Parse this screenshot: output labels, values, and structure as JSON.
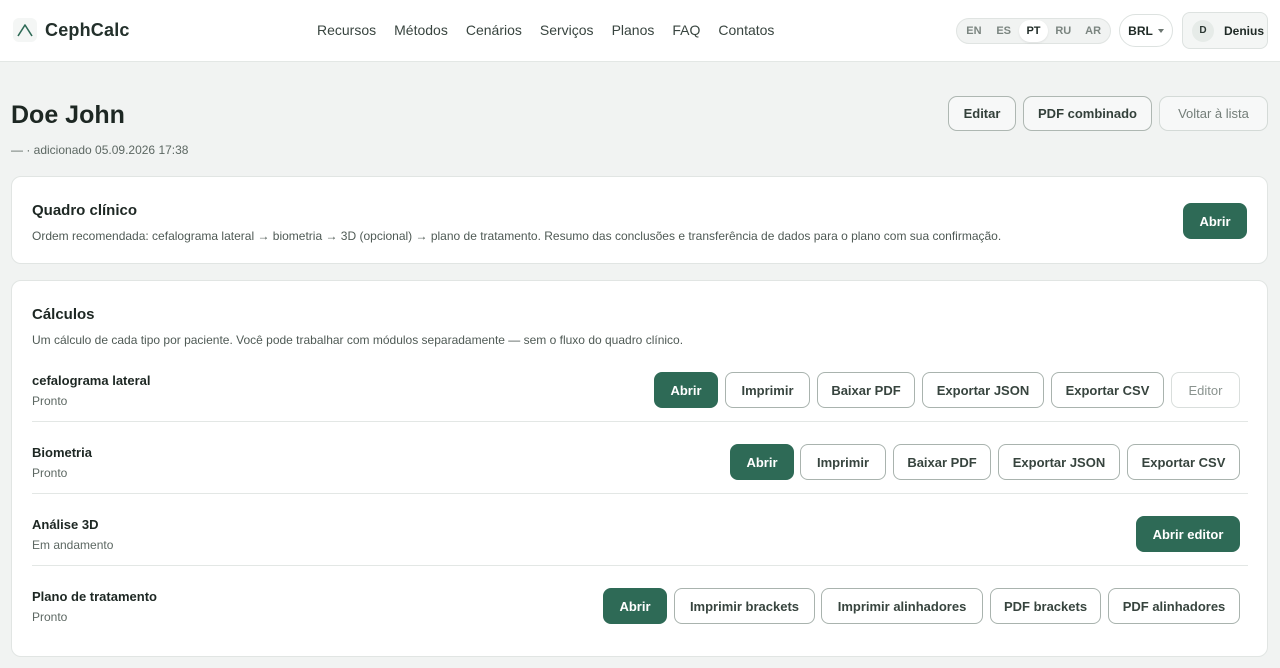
{
  "brand": {
    "name": "CephCalc",
    "icon": "logo-peak-icon",
    "accent": "#2e6a56"
  },
  "nav": [
    "Recursos",
    "Métodos",
    "Cenários",
    "Serviços",
    "Planos",
    "FAQ",
    "Contatos"
  ],
  "languages": [
    {
      "code": "EN",
      "active": false
    },
    {
      "code": "ES",
      "active": false
    },
    {
      "code": "PT",
      "active": true
    },
    {
      "code": "RU",
      "active": false
    },
    {
      "code": "AR",
      "active": false
    }
  ],
  "currency": "BRL",
  "user": {
    "initial": "D",
    "name": "Denius"
  },
  "patient": {
    "name": "Doe John",
    "added": "— · adicionado 05.09.2026 17:38"
  },
  "header_actions": {
    "edit": "Editar",
    "combined_pdf": "PDF combinado",
    "back": "Voltar à lista"
  },
  "clinical": {
    "title": "Quadro clínico",
    "description": "Ordem recomendada: cefalograma lateral → biometria → 3D (opcional) → plano de tratamento. Resumo das conclusões e transferência de dados para o plano com sua confirmação.",
    "open": "Abrir"
  },
  "calculations": {
    "title": "Cálculos",
    "description": "Um cálculo de cada tipo por paciente. Você pode trabalhar com módulos separadamente — sem o fluxo do quadro clínico.",
    "rows": [
      {
        "name": "cefalograma lateral",
        "status": "Pronto",
        "actions": [
          "Abrir",
          "Imprimir",
          "Baixar PDF",
          "Exportar JSON",
          "Exportar CSV",
          "Editor"
        ]
      },
      {
        "name": "Biometria",
        "status": "Pronto",
        "actions": [
          "Abrir",
          "Imprimir",
          "Baixar PDF",
          "Exportar JSON",
          "Exportar CSV"
        ]
      },
      {
        "name": "Análise 3D",
        "status": "Em andamento",
        "actions": [
          "Abrir editor"
        ]
      },
      {
        "name": "Plano de tratamento",
        "status": "Pronto",
        "actions": [
          "Abrir",
          "Imprimir brackets",
          "Imprimir alinhadores",
          "PDF brackets",
          "PDF alinhadores"
        ]
      }
    ]
  }
}
